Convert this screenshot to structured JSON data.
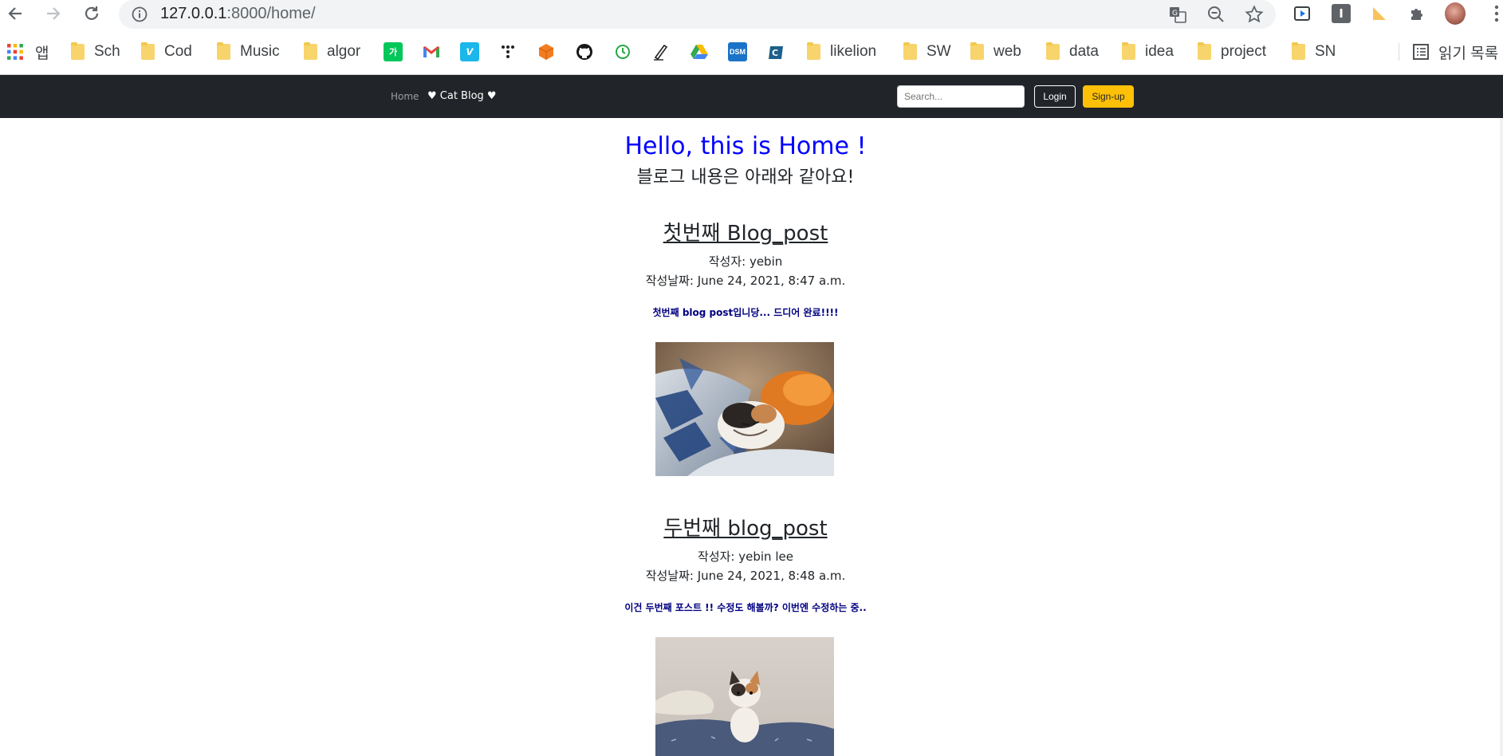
{
  "browser": {
    "url_host": "127.0.0.1",
    "url_path": ":8000/home/",
    "bookmarks": [
      "앱",
      "Sch",
      "Cod",
      "Music",
      "algor",
      "likelion",
      "SW",
      "web",
      "data",
      "idea",
      "project",
      "SN"
    ],
    "bookmark_icon_labels": [
      "가",
      "v",
      "DSM"
    ],
    "reading_list": "읽기 목록"
  },
  "navbar": {
    "home": "Home",
    "brand": "♥ Cat Blog ♥",
    "search_placeholder": "Search...",
    "login": "Login",
    "signup": "Sign-up"
  },
  "page": {
    "title": "Hello, this is Home !",
    "subtitle": "블로그 내용은 아래와 같아요!"
  },
  "posts": [
    {
      "title": "첫번째 Blog_post",
      "author": "작성자: yebin",
      "date": "작성날짜: June 24, 2021, 8:47 a.m.",
      "body": "첫번째 blog post입니당... 드디어 완료!!!!"
    },
    {
      "title": "두번째 blog_post",
      "author": "작성자: yebin lee",
      "date": "작성날짜: June 24, 2021, 8:48 a.m.",
      "body": "이건 두번째 포스트 !! 수정도 해볼까? 이번엔 수정하는 중.."
    }
  ],
  "colors": {
    "navbar_bg": "#212529",
    "title_blue": "#0000ff",
    "post_body_navy": "#000080",
    "signup_yellow": "#ffc107"
  }
}
